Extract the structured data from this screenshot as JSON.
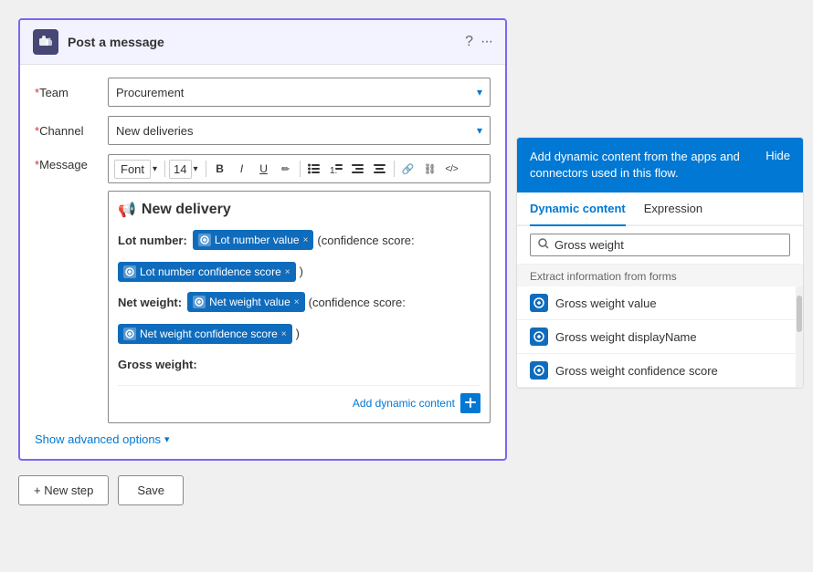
{
  "header": {
    "title": "Post a message",
    "help_icon": "?",
    "more_icon": "···"
  },
  "form": {
    "team_label": "Team",
    "team_required": "*",
    "team_value": "Procurement",
    "channel_label": "Channel",
    "channel_required": "*",
    "channel_value": "New deliveries",
    "message_label": "Message",
    "message_required": "*"
  },
  "toolbar": {
    "font_label": "Font",
    "font_chevron": "▾",
    "size_label": "14",
    "size_chevron": "▾",
    "bold": "B",
    "italic": "I",
    "underline": "U",
    "pen": "✏",
    "bullet_list": "≡",
    "number_list": "≡",
    "indent_less": "⇤",
    "indent_more": "⇥",
    "link": "🔗",
    "unlink": "∞",
    "code": "</>"
  },
  "message_content": {
    "header_icon": "📢",
    "header_text": "New delivery",
    "lot_number_label": "Lot number:",
    "lot_value_chip": "Lot number value",
    "confidence_text1": "(confidence score:",
    "lot_confidence_chip": "Lot number confidence score",
    "closing_paren1": ")",
    "net_weight_label": "Net weight:",
    "net_value_chip": "Net weight value",
    "confidence_text2": "(confidence score:",
    "net_confidence_chip": "Net weight confidence score",
    "closing_paren2": ")",
    "gross_weight_label": "Gross weight:"
  },
  "add_dynamic": {
    "link_text": "Add dynamic content"
  },
  "show_advanced": "Show advanced options",
  "buttons": {
    "new_step": "+ New step",
    "save": "Save"
  },
  "right_panel": {
    "header_text": "Add dynamic content from the apps and connectors used in this flow.",
    "hide_btn": "Hide",
    "tab_dynamic": "Dynamic content",
    "tab_expression": "Expression",
    "search_placeholder": "Gross weight",
    "section_label": "Extract information from forms",
    "items": [
      {
        "label": "Gross weight value"
      },
      {
        "label": "Gross weight displayName"
      },
      {
        "label": "Gross weight confidence score"
      }
    ]
  }
}
